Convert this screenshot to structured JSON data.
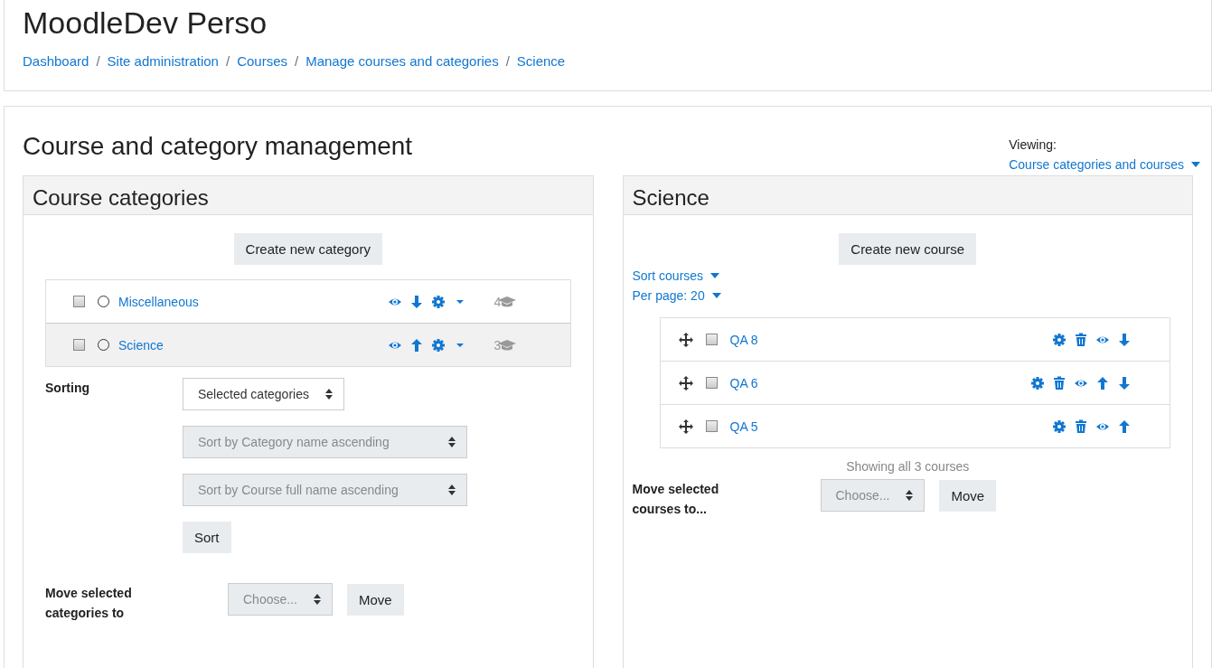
{
  "site_title": "MoodleDev Perso",
  "breadcrumbs": [
    "Dashboard",
    "Site administration",
    "Courses",
    "Manage courses and categories",
    "Science"
  ],
  "breadcrumb_separators": [
    "/",
    "/",
    "/",
    "/"
  ],
  "page_heading": "Course and category management",
  "viewing": {
    "label": "Viewing:",
    "value": "Course categories and courses"
  },
  "categories_panel": {
    "title": "Course categories",
    "create_button": "Create new category",
    "rows": [
      {
        "name": "Miscellaneous",
        "checked": false,
        "selected": false,
        "count": "4",
        "actions": [
          {
            "kind": "eye"
          },
          {
            "kind": "down"
          },
          {
            "kind": "gear"
          },
          {
            "kind": "menu"
          }
        ]
      },
      {
        "name": "Science",
        "checked": false,
        "selected": true,
        "count": "3",
        "actions": [
          {
            "kind": "eye"
          },
          {
            "kind": "up"
          },
          {
            "kind": "gear"
          },
          {
            "kind": "menu"
          }
        ]
      }
    ],
    "sorting": {
      "label": "Sorting",
      "selects": [
        {
          "value": "Selected categories",
          "disabled": false
        },
        {
          "value": "Sort by Category name ascending",
          "disabled": true
        },
        {
          "value": "Sort by Course full name ascending",
          "disabled": true
        }
      ],
      "button": "Sort"
    },
    "move": {
      "label": "Move selected categories to",
      "select": {
        "value": "Choose...",
        "disabled": true
      },
      "button": "Move"
    }
  },
  "courses_panel": {
    "title": "Science",
    "create_button": "Create new course",
    "sort_link": "Sort courses",
    "per_page_link": "Per page: 20",
    "rows": [
      {
        "name": "QA 8",
        "checked": false,
        "actions": [
          {
            "kind": "gear"
          },
          {
            "kind": "trash"
          },
          {
            "kind": "eye"
          },
          {
            "kind": "down"
          }
        ]
      },
      {
        "name": "QA 6",
        "checked": false,
        "actions": [
          {
            "kind": "gear"
          },
          {
            "kind": "trash"
          },
          {
            "kind": "eye"
          },
          {
            "kind": "up"
          },
          {
            "kind": "down"
          }
        ]
      },
      {
        "name": "QA 5",
        "checked": false,
        "actions": [
          {
            "kind": "gear"
          },
          {
            "kind": "trash"
          },
          {
            "kind": "eye"
          },
          {
            "kind": "up"
          }
        ]
      }
    ],
    "showing": "Showing all 3 courses",
    "move": {
      "label": "Move selected courses to...",
      "select": {
        "value": "Choose...",
        "disabled": true
      },
      "button": "Move"
    }
  }
}
